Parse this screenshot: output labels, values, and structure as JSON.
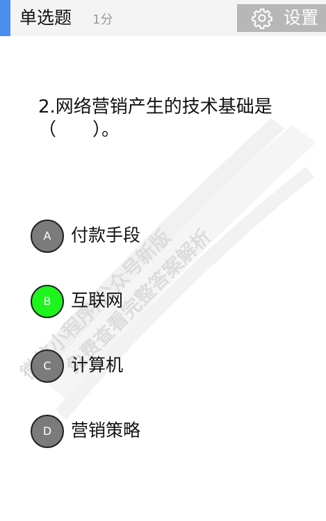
{
  "header": {
    "question_type": "单选题",
    "score": "1分",
    "settings_label": "设置",
    "accent_color": "#4a8ef0"
  },
  "watermark": {
    "line1": "微信小程序/公众号新版",
    "line2": "免费查看完整答案解析"
  },
  "question": {
    "text": "2.网络营销产生的技术基础是（　　）。"
  },
  "options": [
    {
      "letter": "A",
      "text": "付款手段",
      "selected": false
    },
    {
      "letter": "B",
      "text": "互联网",
      "selected": true
    },
    {
      "letter": "C",
      "text": "计算机",
      "selected": false
    },
    {
      "letter": "D",
      "text": "营销策略",
      "selected": false
    }
  ],
  "colors": {
    "option_default": "#7b7b7b",
    "option_selected": "#1df51d",
    "settings_bg": "#b7b7b7"
  }
}
